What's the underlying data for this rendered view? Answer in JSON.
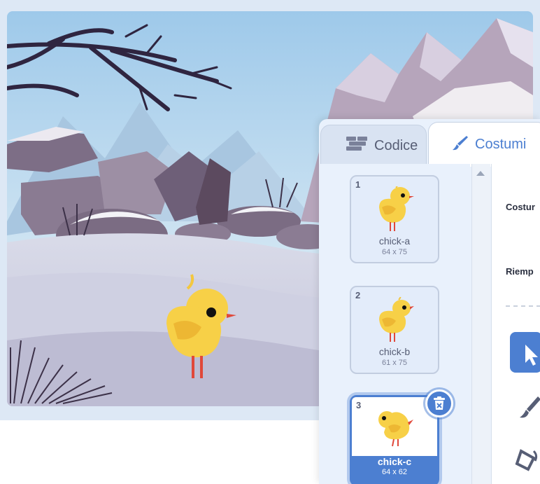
{
  "tabs": {
    "code_label": "Codice",
    "costumes_label": "Costumi"
  },
  "costumes": [
    {
      "number": "1",
      "name": "chick-a",
      "size": "64 x 75",
      "selected": false
    },
    {
      "number": "2",
      "name": "chick-b",
      "size": "61 x 75",
      "selected": false
    },
    {
      "number": "3",
      "name": "chick-c",
      "size": "64 x 62",
      "selected": true
    }
  ],
  "properties": {
    "costume_label": "Costur",
    "fill_label": "Riemp"
  },
  "icons": {
    "code_tab": "code-blocks-icon",
    "costumes_tab": "paintbrush-icon",
    "delete": "trash-icon",
    "select_tool": "cursor-icon",
    "brush_tool": "brush-icon",
    "fill_tool": "bucket-icon"
  },
  "colors": {
    "accent": "#4c7fd1",
    "panel_bg": "#e9f1fc",
    "text": "#575e75"
  }
}
